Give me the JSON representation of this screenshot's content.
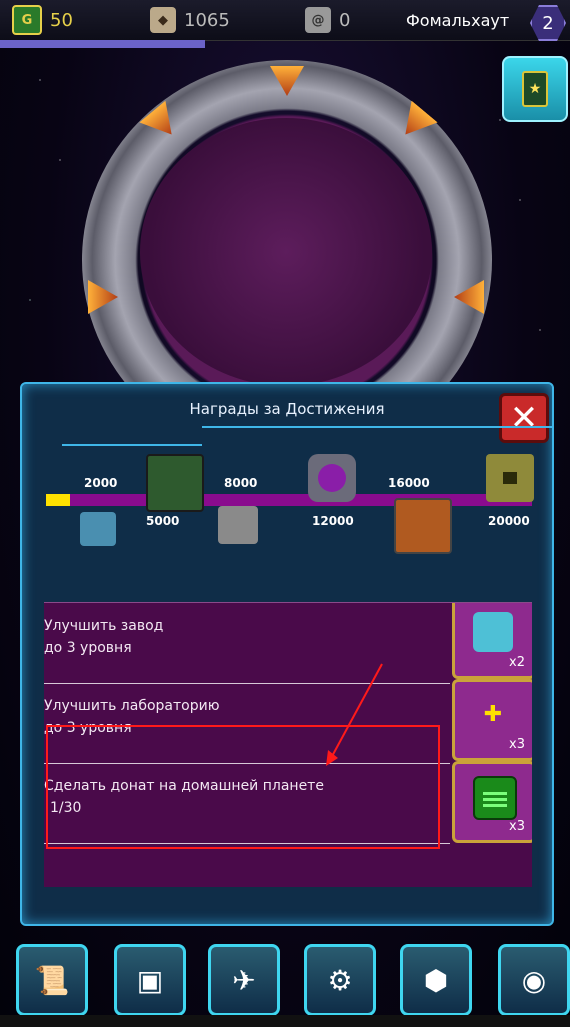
{
  "hud": {
    "gold": "50",
    "crystals": "1065",
    "spiral": "0",
    "planet_name": "Фомальхаут",
    "level": "2",
    "xp_fraction": 0.36
  },
  "dialog": {
    "title": "Награды за Достижения",
    "close_glyph": "✕",
    "progress_fill_fraction": 0.05,
    "milestones_top": [
      "2000",
      "8000",
      "16000"
    ],
    "milestones_bottom": [
      "5000",
      "12000",
      "20000"
    ]
  },
  "achievements": [
    {
      "line1": "Улучшить завод",
      "line2": "до 3 уровня",
      "reward_qty": "x2",
      "reward_icon": "capsule-icon"
    },
    {
      "line1": "Улучшить лабораторию",
      "line2": "до 3 уровня",
      "reward_qty": "x3",
      "reward_icon": "plus-gem-icon"
    },
    {
      "line1": "Сделать донат на домашней планете",
      "line2": "1/30",
      "reward_qty": "x3",
      "reward_icon": "terminal-icon"
    }
  ],
  "bottom_nav": [
    "journal",
    "crate",
    "ship",
    "gears",
    "artifact",
    "radar"
  ],
  "colors": {
    "accent": "#3fb6e8",
    "list_bg": "#4a0a4a",
    "progress": "#8a0b8e",
    "fill": "#ffe100",
    "highlight": "#ff1a1a"
  }
}
